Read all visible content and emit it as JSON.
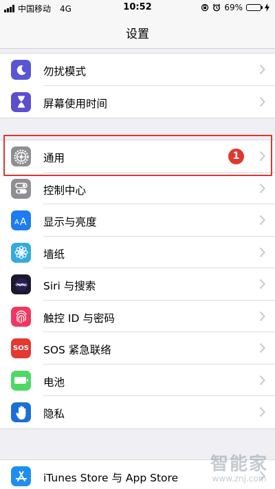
{
  "status_bar": {
    "carrier": "中国移动",
    "network": "4G",
    "time": "10:52",
    "battery_percent": "69%",
    "battery_level": 0.69
  },
  "nav": {
    "title": "设置"
  },
  "items": [
    {
      "label": "勿扰模式",
      "icon": "moon-icon",
      "color": "#5856d6"
    },
    {
      "label": "屏幕使用时间",
      "icon": "hourglass-icon",
      "color": "#5b4fcf"
    },
    {
      "label": "通用",
      "icon": "gear-icon",
      "color": "#8e8e93",
      "badge": "1"
    },
    {
      "label": "控制中心",
      "icon": "toggles-icon",
      "color": "#8e8e93"
    },
    {
      "label": "显示与亮度",
      "icon": "text-size-icon",
      "color": "#1c7cf2"
    },
    {
      "label": "墙纸",
      "icon": "flower-icon",
      "color": "#35aadc"
    },
    {
      "label": "Siri 与搜索",
      "icon": "siri-icon",
      "color": "#1a1a2e"
    },
    {
      "label": "触控 ID 与密码",
      "icon": "fingerprint-icon",
      "color": "#f0375f"
    },
    {
      "label": "SOS 紧急联络",
      "icon": "sos-icon",
      "color": "#e5382f",
      "icon_text": "SOS"
    },
    {
      "label": "电池",
      "icon": "battery-icon",
      "color": "#4cd964"
    },
    {
      "label": "隐私",
      "icon": "hand-icon",
      "color": "#1a6ed8"
    },
    {
      "label": "iTunes Store 与 App Store",
      "icon": "app-store-icon",
      "color": "#1f8ef1"
    }
  ],
  "watermark": {
    "logo": "智能家",
    "url": "www.znj.com"
  }
}
